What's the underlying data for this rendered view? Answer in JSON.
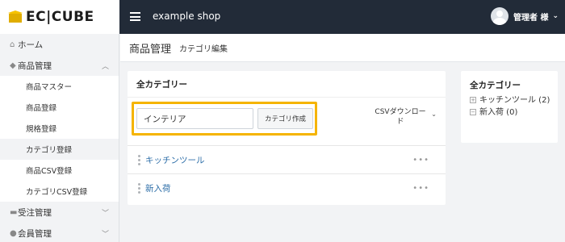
{
  "brand": {
    "logo_text": "EC|CUBE",
    "accent": "#f6c200"
  },
  "header": {
    "shop_name": "example shop",
    "admin_label": "管理者 様"
  },
  "sidebar": {
    "items": [
      {
        "label": "ホーム",
        "icon": "home-icon"
      },
      {
        "label": "商品管理",
        "icon": "tag-icon",
        "expanded": true
      },
      {
        "label": "受注管理",
        "icon": "cart-icon"
      },
      {
        "label": "会員管理",
        "icon": "users-icon"
      }
    ],
    "sub_items": [
      "商品マスター",
      "商品登録",
      "規格登録",
      "カテゴリ登録",
      "商品CSV登録",
      "カテゴリCSV登録"
    ],
    "active_sub": "カテゴリ登録"
  },
  "page": {
    "title": "商品管理",
    "subtitle": "カテゴリ編集"
  },
  "main_card": {
    "title": "全カテゴリー",
    "input_value": "インテリア",
    "create_button": "カテゴリ作成",
    "csv_download_line1": "CSVダウンロー",
    "csv_download_line2": "ド",
    "rows": [
      "キッチンツール",
      "新入荷"
    ],
    "more_label": "•••"
  },
  "side_card": {
    "title": "全カテゴリー",
    "tree": [
      {
        "label": "キッチンツール (2)",
        "toggle": "+"
      },
      {
        "label": "新入荷 (0)",
        "toggle": "−"
      }
    ]
  }
}
